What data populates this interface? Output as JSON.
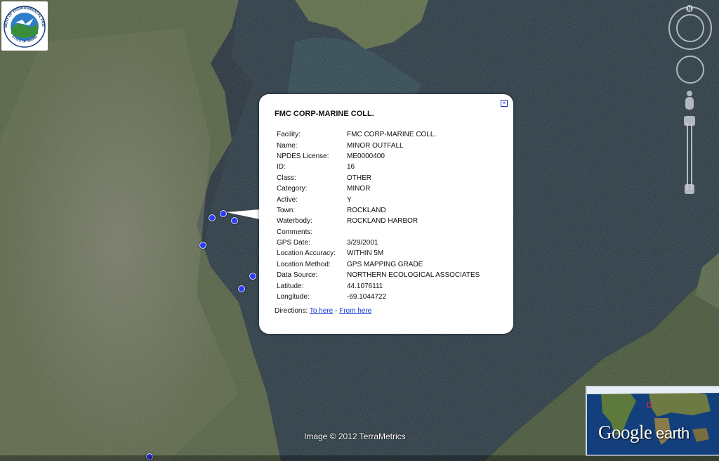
{
  "logo": {
    "ring_text_top": "DEPARTMENT OF ENVIRONMENTAL PROTECTION",
    "ring_text_bottom": "STATE OF MAINE"
  },
  "nav": {
    "north_label": "N"
  },
  "balloon": {
    "title": "FMC CORP-MARINE COLL.",
    "close_icon": "close-icon",
    "fields": [
      {
        "key": "Facility:",
        "value": "FMC CORP-MARINE COLL."
      },
      {
        "key": "Name:",
        "value": "MINOR OUTFALL"
      },
      {
        "key": "NPDES License:",
        "value": "ME0000400"
      },
      {
        "key": "ID:",
        "value": "16"
      },
      {
        "key": "Class:",
        "value": "OTHER"
      },
      {
        "key": "Category:",
        "value": "MINOR"
      },
      {
        "key": "Active:",
        "value": "Y"
      },
      {
        "key": "Town:",
        "value": "ROCKLAND"
      },
      {
        "key": "Waterbody:",
        "value": "ROCKLAND HARBOR"
      },
      {
        "key": "Comments:",
        "value": ""
      },
      {
        "key": "GPS Date:",
        "value": "3/29/2001"
      },
      {
        "key": "Location Accuracy:",
        "value": "WITHIN 5M"
      },
      {
        "key": "Location Method:",
        "value": "GPS MAPPING GRADE"
      },
      {
        "key": "Data Source:",
        "value": "NORTHERN ECOLOGICAL ASSOCIATES"
      },
      {
        "key": "Latitude:",
        "value": "44.1076111"
      },
      {
        "key": "Longitude:",
        "value": "-69.1044722"
      }
    ],
    "directions_label": "Directions: ",
    "to_here": "To here",
    "separator": " - ",
    "from_here": "From here"
  },
  "attribution": "Image © 2012 TerraMetrics",
  "overview": {
    "brand": "Google",
    "brand_suffix": " earth"
  },
  "colors": {
    "water": "#1d2d38",
    "land": "#4a5a3a",
    "pin": "#2d3df2",
    "link": "#1a3bd0"
  }
}
